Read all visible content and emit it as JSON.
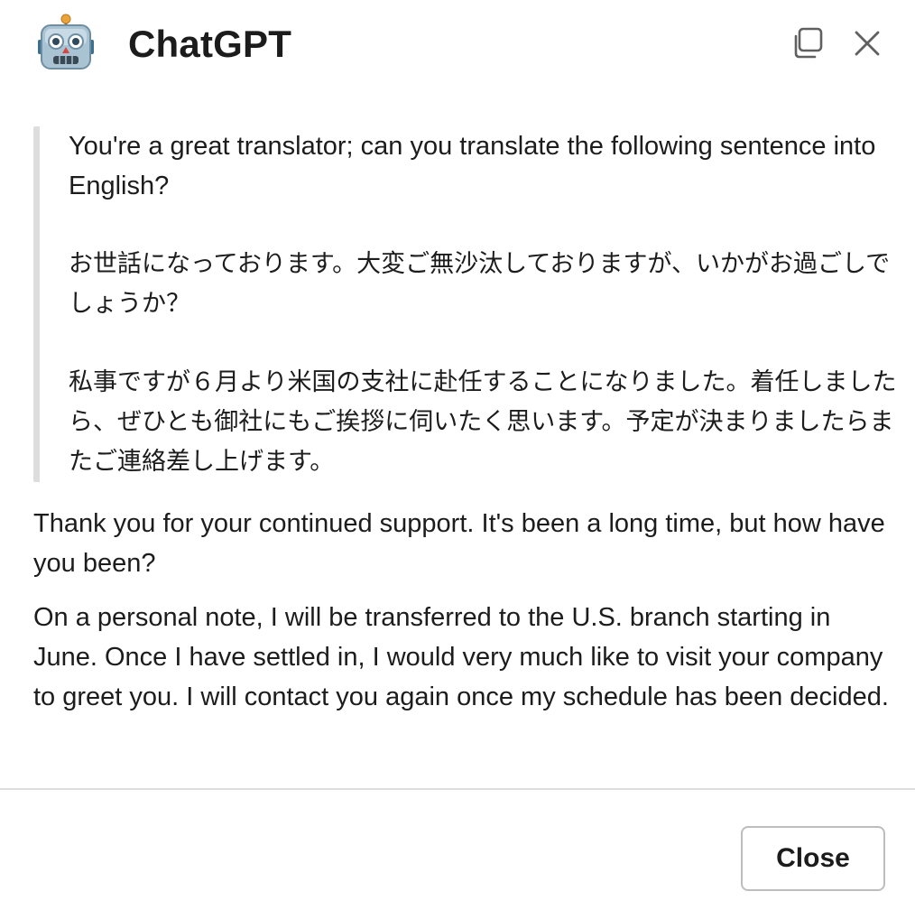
{
  "header": {
    "title": "ChatGPT",
    "icon": "robot-icon",
    "copy_icon": "copy-icon",
    "close_icon": "close-icon"
  },
  "prompt": {
    "intro": "You're a great translator; can you translate the following sentence into English?",
    "paragraph_1": "お世話になっております。大変ご無沙汰しておりますが、いかがお過ごしでしょうか？",
    "paragraph_2": "私事ですが６月より米国の支社に赴任することになりました。着任しましたら、ぜひとも御社にもご挨拶に伺いたく思います。予定が決まりましたらまたご連絡差し上げます。"
  },
  "response": {
    "paragraph_1": "Thank you for your continued support. It's been a long time, but how have you been?",
    "paragraph_2": "On a personal note, I will be transferred to the U.S. branch starting in June. Once I have settled in, I would very much like to visit your company to greet you. I will contact you again once my schedule has been decided."
  },
  "footer": {
    "close_label": "Close"
  },
  "colors": {
    "text": "#1d1c1d",
    "quote_bar": "#dddddd",
    "divider": "#dddddd",
    "button_border": "#bdbdbd"
  }
}
